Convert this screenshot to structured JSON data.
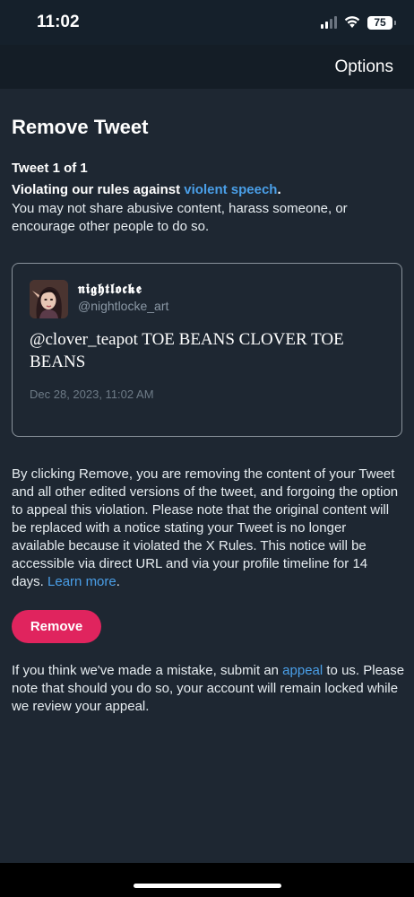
{
  "status_bar": {
    "time": "11:02",
    "battery": "75"
  },
  "nav": {
    "options_label": "Options"
  },
  "page": {
    "title": "Remove Tweet",
    "tweet_count": "Tweet 1 of 1",
    "rule_prefix": "Violating our rules against ",
    "rule_link": "violent speech",
    "rule_suffix": ".",
    "rule_description": "You may not share abusive content, harass someone, or encourage other people to do so."
  },
  "tweet": {
    "display_name": "𝖓𝖎𝖌𝖍𝖙𝖑𝖔𝖈𝖐𝖊",
    "handle": "@nightlocke_art",
    "text": "@clover_teapot TOE BEANS CLOVER TOE BEANS",
    "date": "Dec 28, 2023, 11:02 AM"
  },
  "explanation": {
    "text": "By clicking Remove, you are removing the content of your Tweet and all other edited versions of the tweet, and forgoing the option to appeal this violation. Please note that the original content will be replaced with a notice stating your Tweet is no longer available because it violated the X Rules. This notice will be accessible via direct URL and via your profile timeline for 14 days. ",
    "link": "Learn more",
    "suffix": "."
  },
  "remove_button": {
    "label": "Remove",
    "color": "#e0245e"
  },
  "appeal": {
    "prefix": "If you think we've made a mistake, submit an ",
    "link": "appeal",
    "suffix": " to us. Please note that should you do so, your account will remain locked while we review your appeal."
  },
  "colors": {
    "background": "#1e2732",
    "link": "#4a9fe8",
    "nav": "#141d26"
  }
}
